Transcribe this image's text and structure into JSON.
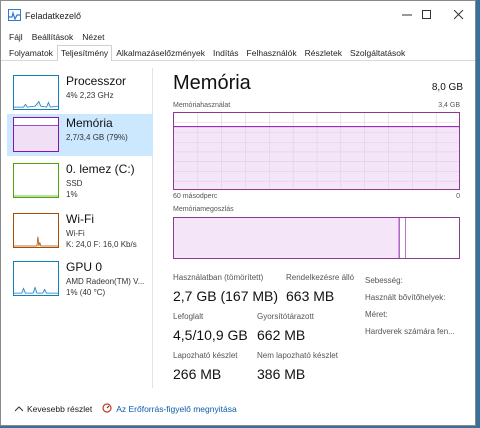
{
  "window": {
    "title": "Feladatkezelő"
  },
  "menu": [
    "Fájl",
    "Beállítások",
    "Nézet"
  ],
  "tabs": [
    "Folyamatok",
    "Teljesítmény",
    "Alkalmazáselőzmények",
    "Indítás",
    "Felhasználók",
    "Részletek",
    "Szolgáltatások"
  ],
  "active_tab": "Teljesítmény",
  "sidebar": {
    "items": [
      {
        "title": "Processzor",
        "sub1": "4% 2,23 GHz",
        "sub2": "",
        "sub3": "",
        "color": "#117dbb"
      },
      {
        "title": "Memória",
        "sub1": "2,7/3,4 GB (79%)",
        "sub2": "",
        "sub3": "",
        "color": "#8b12ae"
      },
      {
        "title": "0. lemez (C:)",
        "sub1": "SSD",
        "sub2": "1%",
        "sub3": "",
        "color": "#4da60c"
      },
      {
        "title": "Wi-Fi",
        "sub1": "Wi-Fi",
        "sub2": "K: 24,0 F: 16,0 Kb/s",
        "sub3": "",
        "color": "#a74f01"
      },
      {
        "title": "GPU 0",
        "sub1": "AMD Radeon(TM) V...",
        "sub2": "1% (40 °C)",
        "sub3": "",
        "color": "#117dbb"
      }
    ]
  },
  "main": {
    "title": "Memória",
    "total": "8,0 GB",
    "usage_label": "Memóriahasználat",
    "usage_max": "3,4 GB",
    "time_label": "60 másodperc",
    "time_zero": "0",
    "composition_label": "Memóriamegoszlás",
    "in_use_fraction": 0.79,
    "stats": {
      "in_use_label": "Használatban (tömörített)",
      "in_use_value": "2,7 GB (167 MB)",
      "available_label": "Rendelkezésre álló",
      "available_value": "663 MB",
      "committed_label": "Lefoglalt",
      "committed_value": "4,5/10,9 GB",
      "cached_label": "Gyorsítótárazott",
      "cached_value": "662 MB",
      "paged_label": "Lapozható készlet",
      "paged_value": "266 MB",
      "nonpaged_label": "Nem lapozható készlet",
      "nonpaged_value": "386 MB",
      "speed_label": "Sebesség:",
      "slots_label": "Használt bővítőhelyek:",
      "form_label": "Méret:",
      "hw_reserved_label": "Hardverek számára fen..."
    }
  },
  "footer": {
    "less_details": "Kevesebb részlet",
    "open_monitor": "Az Erőforrás-figyelő megnyitása"
  },
  "colors": {
    "memory": "#8b12ae",
    "selection": "#cce8ff",
    "link": "#0b5cad"
  }
}
